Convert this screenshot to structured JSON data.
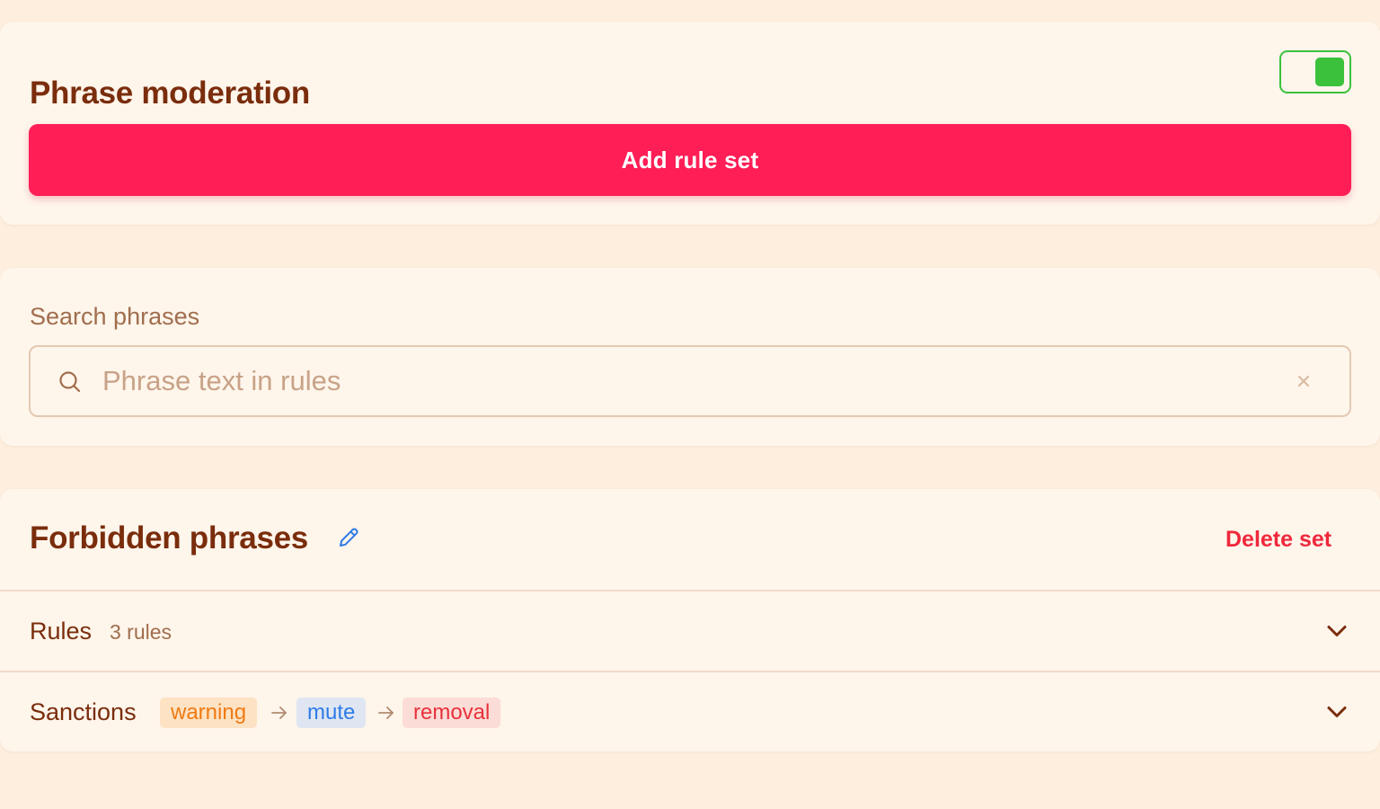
{
  "moderation": {
    "title": "Phrase moderation",
    "enabled": true,
    "add_button_label": "Add rule set"
  },
  "search": {
    "label": "Search phrases",
    "placeholder": "Phrase text in rules",
    "value": ""
  },
  "rule_set": {
    "title": "Forbidden phrases",
    "delete_label": "Delete set",
    "rules_label": "Rules",
    "rules_count": "3 rules",
    "sanctions_label": "Sanctions",
    "sanctions": [
      "warning",
      "mute",
      "removal"
    ]
  },
  "colors": {
    "accent": "#ff1e56",
    "toggle_on": "#3cc13c",
    "title_text": "#7a2d0c",
    "danger": "#f0283c",
    "page_bg": "#fdeedd",
    "card_bg": "#fef5eb",
    "chip_warning_bg": "#fde2c4",
    "chip_warning_text": "#f07a12",
    "chip_mute_bg": "#dfe6f2",
    "chip_mute_text": "#2e7be6",
    "chip_removal_bg": "#fbdcd6",
    "chip_removal_text": "#e8323c"
  },
  "icons": {
    "toggle": "toggle-switch",
    "search": "search-icon",
    "clear": "close-icon",
    "edit": "pencil-icon",
    "expand": "chevron-down-icon",
    "sequence": "arrow-right-icon"
  }
}
